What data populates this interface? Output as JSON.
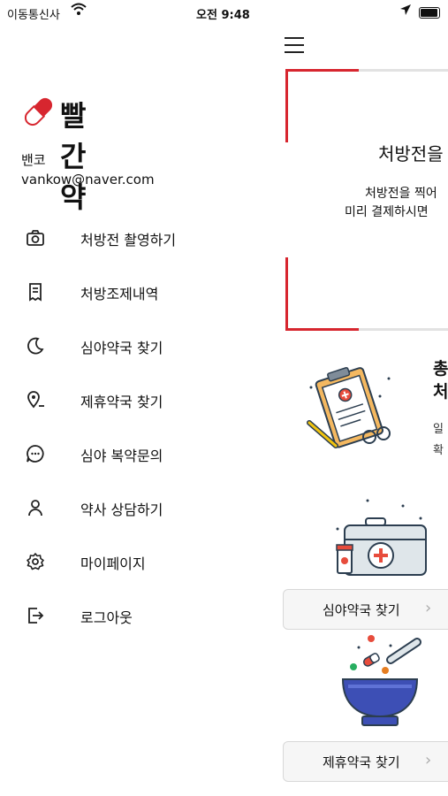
{
  "status_bar": {
    "carrier": "이동통신사",
    "time": "오전 9:48"
  },
  "app": {
    "brand": "빨간약"
  },
  "user": {
    "name": "밴코",
    "email": "vankow@naver.com"
  },
  "menu": [
    {
      "label": "처방전 촬영하기",
      "icon": "camera-icon"
    },
    {
      "label": "처방조제내역",
      "icon": "receipt-icon"
    },
    {
      "label": "심야약국 찾기",
      "icon": "moon-icon"
    },
    {
      "label": "제휴약국 찾기",
      "icon": "location-pin-icon"
    },
    {
      "label": "심야 복약문의",
      "icon": "chat-icon"
    },
    {
      "label": "약사 상담하기",
      "icon": "person-icon"
    },
    {
      "label": "마이페이지",
      "icon": "gear-icon"
    },
    {
      "label": "로그아웃",
      "icon": "logout-icon"
    }
  ],
  "main": {
    "card1": {
      "title": "처방전을",
      "line1": "처방전을 찍어",
      "line2": "미리 결제하시면"
    },
    "card2": {
      "title1": "총",
      "title2": "처",
      "sub1": "일",
      "sub2": "확"
    },
    "night_pharmacy_button": "심야약국 찾기",
    "partner_pharmacy_button": "제휴약국 찾기"
  },
  "colors": {
    "accent": "#d7262f"
  }
}
